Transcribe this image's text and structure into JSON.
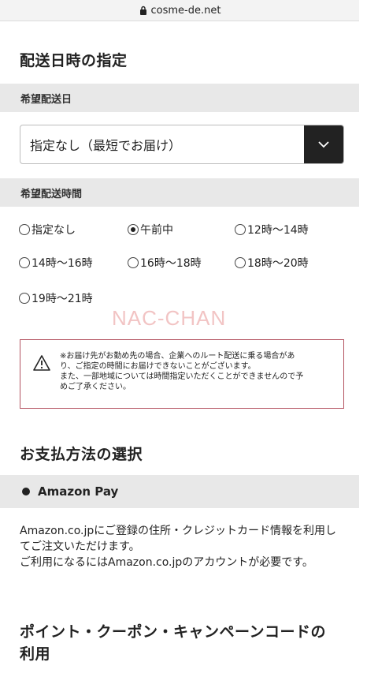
{
  "browser": {
    "url": "cosme-de.net"
  },
  "delivery": {
    "title": "配送日時の指定",
    "date_label": "希望配送日",
    "date_value": "指定なし（最短でお届け）",
    "time_label": "希望配送時間",
    "time_options": [
      {
        "label": "指定なし",
        "selected": false
      },
      {
        "label": "午前中",
        "selected": true
      },
      {
        "label": "12時〜14時",
        "selected": false
      },
      {
        "label": "14時〜16時",
        "selected": false
      },
      {
        "label": "16時〜18時",
        "selected": false
      },
      {
        "label": "18時〜20時",
        "selected": false
      },
      {
        "label": "19時〜21時",
        "selected": false
      }
    ],
    "notice_lines": [
      "※お届け先がお勤め先の場合、企業へのルート配送に乗る場合があ",
      "り、ご指定の時間にお届けできないことがございます。",
      "また、一部地域については時間指定いただくことができませんので予",
      "めご了承ください。"
    ]
  },
  "watermark": "NAC-CHAN",
  "payment": {
    "title": "お支払方法の選択",
    "option_label": "Amazon Pay",
    "description_lines": [
      "Amazon.co.jpにご登録の住所・クレジットカード情報を利用し",
      "てご注文いただけます。",
      "ご利用になるにはAmazon.co.jpのアカウントが必要です。"
    ]
  },
  "points": {
    "title_lines": [
      "ポイント・クーポン・キャンペーンコードの",
      "利用"
    ]
  }
}
